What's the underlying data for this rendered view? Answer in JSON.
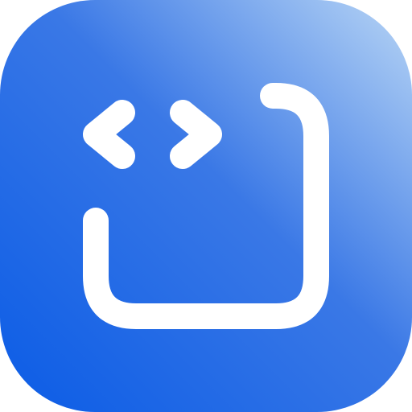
{
  "icon": {
    "name": "code-snippet-app-icon",
    "glyph": "code-brackets-icon",
    "frame_glyph": "open-square-frame-icon",
    "colors": {
      "gradient_start": "#0b5ce6",
      "gradient_mid": "#3a78e6",
      "gradient_end": "#b9d6f5",
      "foreground": "#ffffff"
    }
  }
}
